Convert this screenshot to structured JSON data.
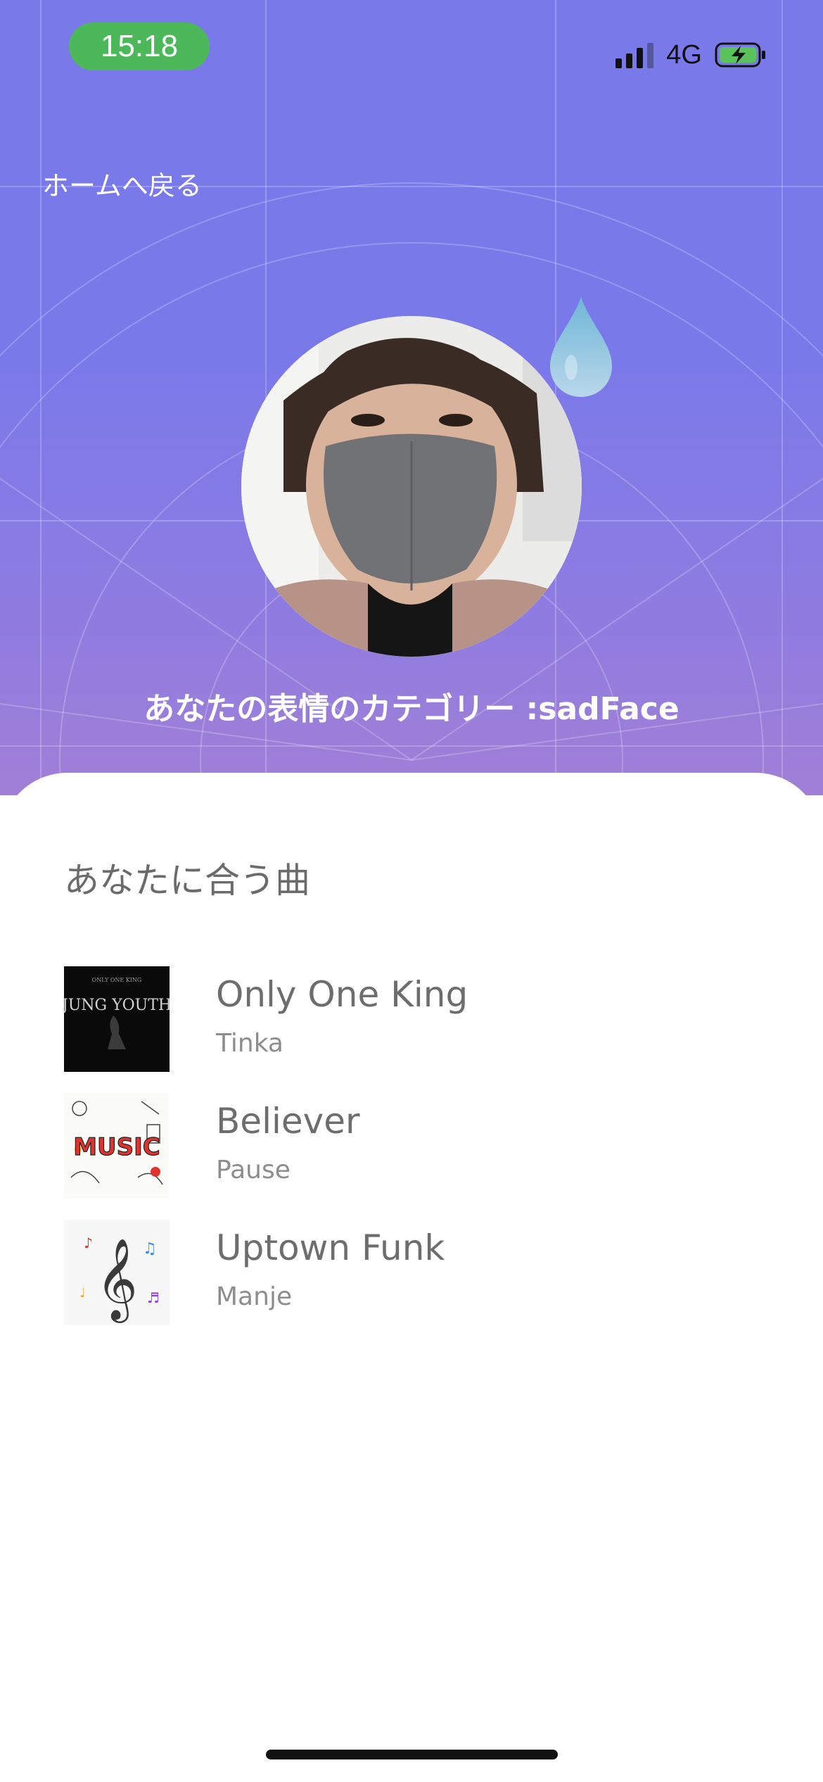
{
  "status_bar": {
    "time": "15:18",
    "network": "4G",
    "icons": [
      "signal-icon",
      "battery-charging-icon"
    ]
  },
  "nav": {
    "back_label": "ホームへ戻る"
  },
  "emotion": {
    "category_text": "あなたの表情のカテゴリー :sadFace",
    "emoji_icon": "teardrop-icon"
  },
  "recommendations": {
    "title": "あなたに合う曲",
    "songs": [
      {
        "title": "Only One King",
        "artist": "Tinka",
        "cover_text": "JUNG YOUTH",
        "cover_subtext": "ONLY ONE KING"
      },
      {
        "title": "Believer",
        "artist": "Pause",
        "cover_text": "MUSIC"
      },
      {
        "title": "Uptown Funk",
        "artist": "Manje",
        "cover_icon": "treble-clef-icon"
      }
    ]
  },
  "colors": {
    "header_gradient_top": "#7a79ea",
    "header_gradient_bottom": "#a17fd6",
    "time_pill": "#4cb85a",
    "sheet_background": "#ffffff",
    "song_title": "#6d6d6d",
    "song_artist": "#8d8d8d"
  }
}
